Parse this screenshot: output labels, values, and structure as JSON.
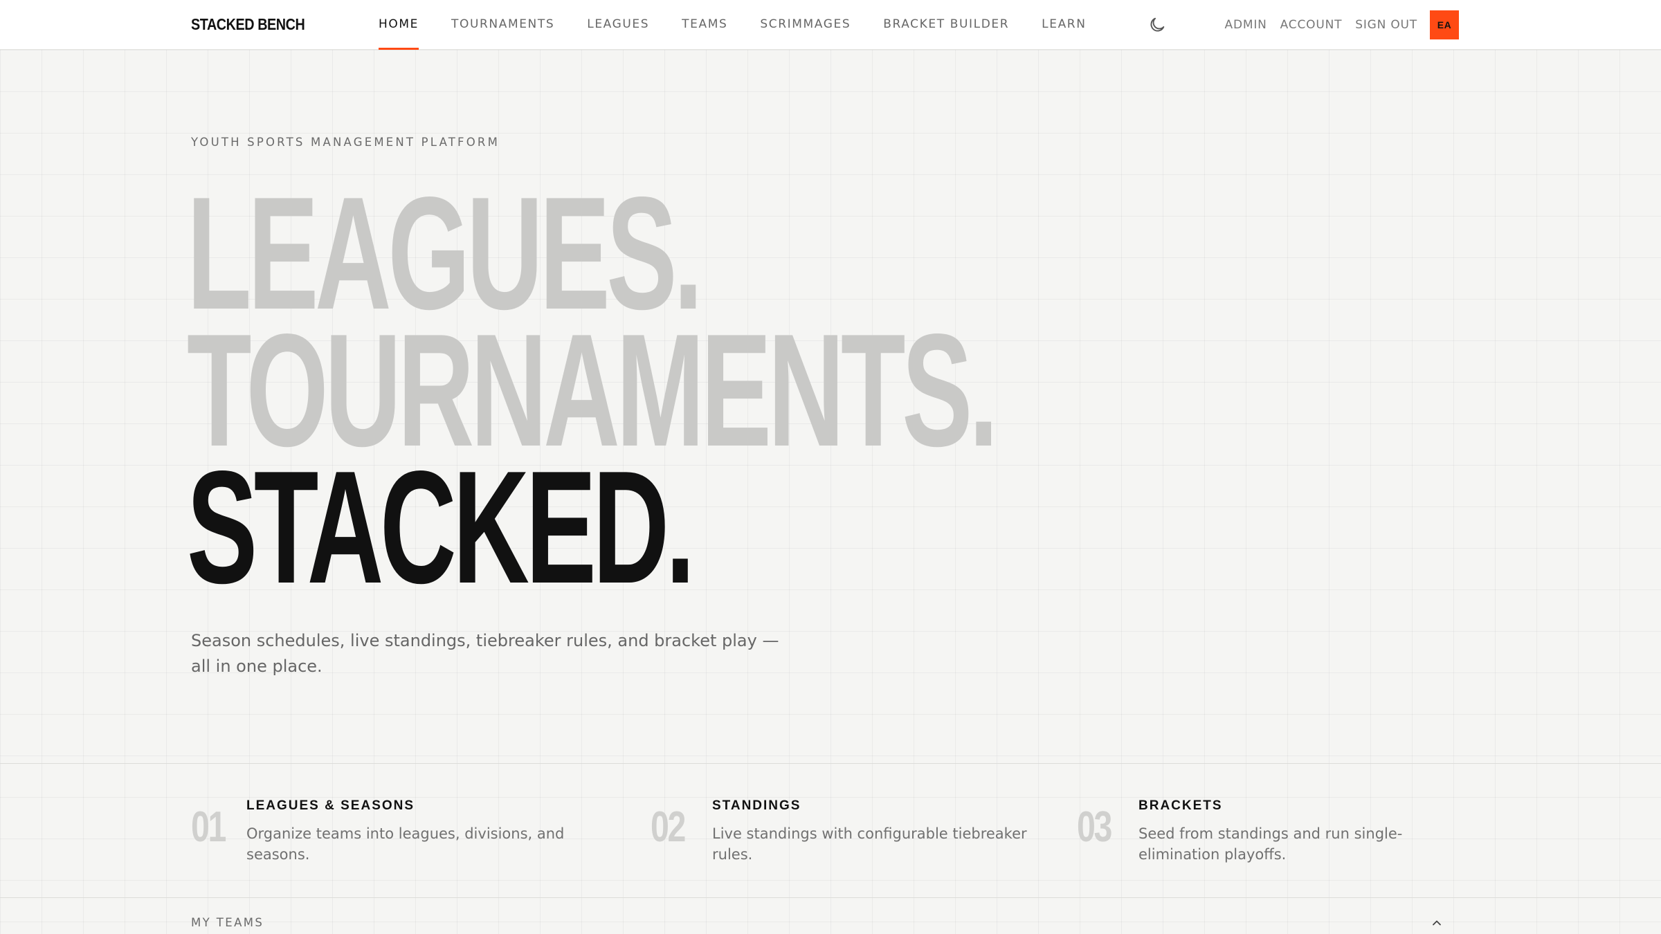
{
  "nav": {
    "brand": "STACKED BENCH",
    "links": [
      {
        "label": "HOME",
        "active": true
      },
      {
        "label": "TOURNAMENTS",
        "active": false
      },
      {
        "label": "LEAGUES",
        "active": false
      },
      {
        "label": "TEAMS",
        "active": false
      },
      {
        "label": "SCRIMMAGES",
        "active": false
      },
      {
        "label": "BRACKET BUILDER",
        "active": false
      },
      {
        "label": "LEARN",
        "active": false
      }
    ],
    "theme_toggle_icon": "moon-icon",
    "admin": "ADMIN",
    "account": "ACCOUNT",
    "sign_out": "SIGN OUT",
    "avatar_initials": "EA"
  },
  "hero": {
    "eyebrow": "YOUTH SPORTS MANAGEMENT PLATFORM",
    "line1": "LEAGUES.",
    "line2": "TOURNAMENTS.",
    "line3": "STACKED.",
    "lede": "Season schedules, live standings, tiebreaker rules, and bracket play — all in one place."
  },
  "features": [
    {
      "num": "01",
      "title": "LEAGUES & SEASONS",
      "desc": "Organize teams into leagues, divisions, and seasons."
    },
    {
      "num": "02",
      "title": "STANDINGS",
      "desc": "Live standings with configurable tiebreaker rules."
    },
    {
      "num": "03",
      "title": "BRACKETS",
      "desc": "Seed from standings and run single-elimination playoffs."
    }
  ],
  "my_teams": {
    "label": "MY TEAMS",
    "toggle_icon": "chevron-up-icon"
  },
  "colors": {
    "accent": "#ff4a14",
    "background": "#f5f5f3",
    "headline_faded": "#c9c9c7",
    "headline_dark": "#111111"
  }
}
